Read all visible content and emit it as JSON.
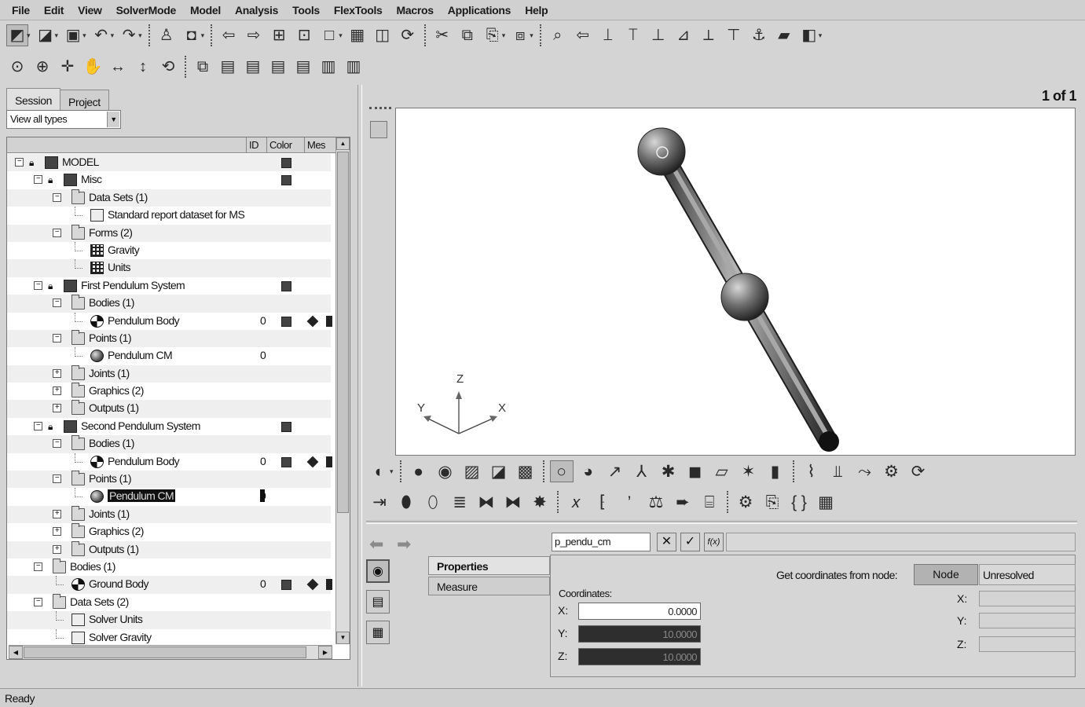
{
  "menu": [
    "File",
    "Edit",
    "View",
    "SolverMode",
    "Model",
    "Analysis",
    "Tools",
    "FlexTools",
    "Macros",
    "Applications",
    "Help"
  ],
  "toolbar1": [
    {
      "icon": "model-browse-icon",
      "glyph": "◩"
    },
    {
      "icon": "open-model-icon",
      "glyph": "◪"
    },
    {
      "icon": "save-icon",
      "glyph": "▣"
    },
    {
      "icon": "undo-icon",
      "glyph": "↶"
    },
    {
      "icon": "redo-icon",
      "glyph": "↷"
    },
    {
      "icon": "user-icon",
      "glyph": "♙"
    },
    {
      "icon": "camera-icon",
      "glyph": "◘"
    },
    {
      "icon": "back-arrow-icon",
      "glyph": "⇦"
    },
    {
      "icon": "forward-arrow-icon",
      "glyph": "⇨"
    },
    {
      "icon": "page-add-icon",
      "glyph": "⊞"
    },
    {
      "icon": "page-icon",
      "glyph": "⊡"
    },
    {
      "icon": "window-icon",
      "glyph": "□"
    },
    {
      "icon": "layout-icon",
      "glyph": "▦"
    },
    {
      "icon": "split-icon",
      "glyph": "◫"
    },
    {
      "icon": "sync-icon",
      "glyph": "⟳"
    },
    {
      "icon": "cut-icon",
      "glyph": "✂"
    },
    {
      "icon": "copy-icon",
      "glyph": "⧉"
    },
    {
      "icon": "paste-icon",
      "glyph": "⎘"
    },
    {
      "icon": "duplicate-icon",
      "glyph": "⧈"
    },
    {
      "icon": "find-icon",
      "glyph": "⌕"
    },
    {
      "icon": "left-icon",
      "glyph": "⇦"
    },
    {
      "icon": "view-x-icon",
      "glyph": "⟘"
    },
    {
      "icon": "view-y-icon",
      "glyph": "⟙"
    },
    {
      "icon": "view-z-icon",
      "glyph": "⊥"
    },
    {
      "icon": "view-iso-icon",
      "glyph": "⊿"
    },
    {
      "icon": "view-back-icon",
      "glyph": "⟂"
    },
    {
      "icon": "view-top-icon",
      "glyph": "⊤"
    },
    {
      "icon": "anchor-icon",
      "glyph": "⚓"
    },
    {
      "icon": "book-icon",
      "glyph": "▰"
    },
    {
      "icon": "export-icon",
      "glyph": "◧"
    }
  ],
  "toolbar2": [
    {
      "icon": "zoom-fit-icon",
      "glyph": "⊙"
    },
    {
      "icon": "zoom-icon",
      "glyph": "⊕"
    },
    {
      "icon": "move-icon",
      "glyph": "✛"
    },
    {
      "icon": "pan-hand-icon",
      "glyph": "✋"
    },
    {
      "icon": "horizontal-icon",
      "glyph": "↔"
    },
    {
      "icon": "vertical-icon",
      "glyph": "↕"
    },
    {
      "icon": "rotate-icon",
      "glyph": "⟲"
    },
    {
      "icon": "copy-view-icon",
      "glyph": "⧉"
    },
    {
      "icon": "save-view-1-icon",
      "glyph": "▤"
    },
    {
      "icon": "save-view-2-icon",
      "glyph": "▤"
    },
    {
      "icon": "save-view-3-icon",
      "glyph": "▤"
    },
    {
      "icon": "save-view-4-icon",
      "glyph": "▤"
    },
    {
      "icon": "recall-view-1-icon",
      "glyph": "▥"
    },
    {
      "icon": "recall-view-2-icon",
      "glyph": "▥"
    }
  ],
  "tabs": [
    "Session",
    "Project"
  ],
  "filter_value": "View all types",
  "columns": [
    "ID",
    "Color",
    "Mes"
  ],
  "tree": [
    {
      "depth": 0,
      "exp": "−",
      "lock": true,
      "icon": "model",
      "label": "MODEL",
      "id": "",
      "color": true,
      "mesh": false
    },
    {
      "depth": 1,
      "exp": "−",
      "lock": true,
      "icon": "model",
      "label": "Misc",
      "id": "",
      "color": true,
      "mesh": false
    },
    {
      "depth": 2,
      "exp": "−",
      "lock": false,
      "icon": "folder",
      "label": "Data Sets (1)",
      "id": "",
      "color": false,
      "mesh": false
    },
    {
      "depth": 3,
      "exp": "",
      "lock": false,
      "icon": "dataset",
      "label": "Standard report dataset for MS",
      "id": "",
      "color": false,
      "mesh": false
    },
    {
      "depth": 2,
      "exp": "−",
      "lock": false,
      "icon": "folder",
      "label": "Forms (2)",
      "id": "",
      "color": false,
      "mesh": false
    },
    {
      "depth": 3,
      "exp": "",
      "lock": false,
      "icon": "grid",
      "label": "Gravity",
      "id": "",
      "color": false,
      "mesh": false
    },
    {
      "depth": 3,
      "exp": "",
      "lock": false,
      "icon": "grid",
      "label": "Units",
      "id": "",
      "color": false,
      "mesh": false
    },
    {
      "depth": 1,
      "exp": "−",
      "lock": true,
      "icon": "model",
      "label": "First Pendulum System",
      "id": "",
      "color": true,
      "mesh": false
    },
    {
      "depth": 2,
      "exp": "−",
      "lock": false,
      "icon": "folder",
      "label": "Bodies (1)",
      "id": "",
      "color": false,
      "mesh": false
    },
    {
      "depth": 3,
      "exp": "",
      "lock": false,
      "icon": "body",
      "label": "Pendulum Body",
      "id": "0",
      "color": true,
      "mesh": true
    },
    {
      "depth": 2,
      "exp": "−",
      "lock": false,
      "icon": "folder",
      "label": "Points (1)",
      "id": "",
      "color": false,
      "mesh": false
    },
    {
      "depth": 3,
      "exp": "",
      "lock": false,
      "icon": "point",
      "label": "Pendulum CM",
      "id": "0",
      "color": false,
      "mesh": false
    },
    {
      "depth": 2,
      "exp": "+",
      "lock": false,
      "icon": "folder",
      "label": "Joints (1)",
      "id": "",
      "color": false,
      "mesh": false
    },
    {
      "depth": 2,
      "exp": "+",
      "lock": false,
      "icon": "folder",
      "label": "Graphics (2)",
      "id": "",
      "color": false,
      "mesh": false
    },
    {
      "depth": 2,
      "exp": "+",
      "lock": false,
      "icon": "folder",
      "label": "Outputs (1)",
      "id": "",
      "color": false,
      "mesh": false
    },
    {
      "depth": 1,
      "exp": "−",
      "lock": true,
      "icon": "model",
      "label": "Second Pendulum System",
      "id": "",
      "color": true,
      "mesh": false
    },
    {
      "depth": 2,
      "exp": "−",
      "lock": false,
      "icon": "folder",
      "label": "Bodies (1)",
      "id": "",
      "color": false,
      "mesh": false
    },
    {
      "depth": 3,
      "exp": "",
      "lock": false,
      "icon": "body",
      "label": "Pendulum Body",
      "id": "0",
      "color": true,
      "mesh": true
    },
    {
      "depth": 2,
      "exp": "−",
      "lock": false,
      "icon": "folder",
      "label": "Points (1)",
      "id": "",
      "color": false,
      "mesh": false
    },
    {
      "depth": 3,
      "exp": "",
      "lock": false,
      "icon": "point",
      "label": "Pendulum CM",
      "id": "0",
      "color": false,
      "mesh": false,
      "selected": true
    },
    {
      "depth": 2,
      "exp": "+",
      "lock": false,
      "icon": "folder",
      "label": "Joints (1)",
      "id": "",
      "color": false,
      "mesh": false
    },
    {
      "depth": 2,
      "exp": "+",
      "lock": false,
      "icon": "folder",
      "label": "Graphics (2)",
      "id": "",
      "color": false,
      "mesh": false
    },
    {
      "depth": 2,
      "exp": "+",
      "lock": false,
      "icon": "folder",
      "label": "Outputs (1)",
      "id": "",
      "color": false,
      "mesh": false
    },
    {
      "depth": 1,
      "exp": "−",
      "lock": false,
      "icon": "folder",
      "label": "Bodies (1)",
      "id": "",
      "color": false,
      "mesh": false
    },
    {
      "depth": 2,
      "exp": "",
      "lock": false,
      "icon": "body",
      "label": "Ground Body",
      "id": "0",
      "color": true,
      "mesh": true
    },
    {
      "depth": 1,
      "exp": "−",
      "lock": false,
      "icon": "folder",
      "label": "Data Sets (2)",
      "id": "",
      "color": false,
      "mesh": false
    },
    {
      "depth": 2,
      "exp": "",
      "lock": false,
      "icon": "dataset",
      "label": "Solver Units",
      "id": "",
      "color": false,
      "mesh": false
    },
    {
      "depth": 2,
      "exp": "",
      "lock": false,
      "icon": "dataset",
      "label": "Solver Gravity",
      "id": "",
      "color": false,
      "mesh": false
    }
  ],
  "page_count": "1 of 1",
  "axes": {
    "x": "X",
    "y": "Y",
    "z": "Z"
  },
  "viewtb1": [
    {
      "icon": "display-mode-icon",
      "glyph": "◐"
    },
    {
      "icon": "shaded-icon",
      "glyph": "●"
    },
    {
      "icon": "wire-shaded-icon",
      "glyph": "◉"
    },
    {
      "icon": "image-icon",
      "glyph": "▨"
    },
    {
      "icon": "chart-icon",
      "glyph": "◪"
    },
    {
      "icon": "cs-icon",
      "glyph": "▩"
    },
    {
      "icon": "point-entity-icon",
      "glyph": "○"
    },
    {
      "icon": "body-entity-icon",
      "glyph": "◕"
    },
    {
      "icon": "vector-icon",
      "glyph": "↗"
    },
    {
      "icon": "marker-icon",
      "glyph": "⅄"
    },
    {
      "icon": "joint-icon",
      "glyph": "✱"
    },
    {
      "icon": "box-icon",
      "glyph": "◼"
    },
    {
      "icon": "plane-icon",
      "glyph": "▱"
    },
    {
      "icon": "force-icon",
      "glyph": "✶"
    },
    {
      "icon": "surface-icon",
      "glyph": "▮"
    },
    {
      "icon": "spring-icon",
      "glyph": "⌇"
    },
    {
      "icon": "beam-icon",
      "glyph": "⫫"
    },
    {
      "icon": "motion-icon",
      "glyph": "⤳"
    },
    {
      "icon": "gear-icon",
      "glyph": "⚙"
    },
    {
      "icon": "cycle-icon",
      "glyph": "⟳"
    }
  ],
  "viewtb2": [
    {
      "icon": "connector-icon",
      "glyph": "⇥"
    },
    {
      "icon": "cylinder-icon",
      "glyph": "⬮"
    },
    {
      "icon": "cylinder2-icon",
      "glyph": "⬯"
    },
    {
      "icon": "spring2-icon",
      "glyph": "≣"
    },
    {
      "icon": "bushing-icon",
      "glyph": "⧓"
    },
    {
      "icon": "bushing2-icon",
      "glyph": "⧓"
    },
    {
      "icon": "contact-icon",
      "glyph": "✸"
    },
    {
      "icon": "variable-icon",
      "glyph": "𝑥"
    },
    {
      "icon": "array-icon",
      "glyph": "⁅"
    },
    {
      "icon": "string-icon",
      "glyph": "’"
    },
    {
      "icon": "solver-icon",
      "glyph": "⚖"
    },
    {
      "icon": "output-icon",
      "glyph": "➨"
    },
    {
      "icon": "form-icon",
      "glyph": "⌸"
    },
    {
      "icon": "sensor-icon",
      "glyph": "⚙"
    },
    {
      "icon": "template-icon",
      "glyph": "⎘"
    },
    {
      "icon": "braces-icon",
      "glyph": "{ }"
    },
    {
      "icon": "table-icon",
      "glyph": "▦"
    }
  ],
  "name_value": "p_pendu_cm",
  "name_buttons": {
    "cancel": "✕",
    "ok": "✓",
    "expr": "f(x)"
  },
  "prop_tabs": [
    "Properties",
    "Measure"
  ],
  "coords_label": "Coordinates:",
  "coords": [
    {
      "axis": "X:",
      "value": "0.0000",
      "dark": false
    },
    {
      "axis": "Y:",
      "value": "10.0000",
      "dark": true
    },
    {
      "axis": "Z:",
      "value": "10.0000",
      "dark": true
    }
  ],
  "node_label": "Get coordinates from node:",
  "node_button": "Node",
  "node_status": "Unresolved",
  "node_axes": [
    "X:",
    "Y:",
    "Z:"
  ],
  "status": "Ready"
}
